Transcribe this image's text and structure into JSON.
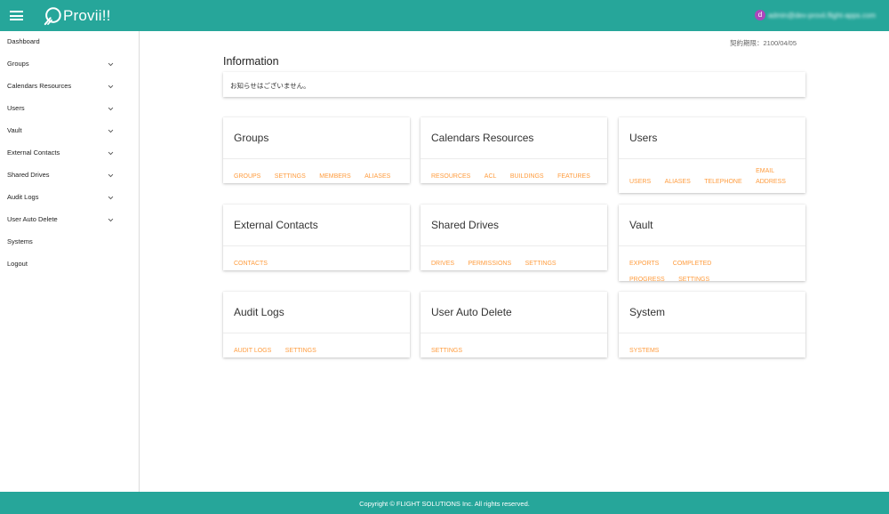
{
  "app": {
    "name": "Provii!!",
    "user_avatar_letter": "d",
    "user_email": "admin@dev-provii.flight-apps.com"
  },
  "colors": {
    "primary": "#26a69a",
    "link": "#ff9c3e",
    "avatar": "#ab47bc"
  },
  "sidebar": {
    "items": [
      {
        "label": "Dashboard",
        "expandable": false
      },
      {
        "label": "Groups",
        "expandable": true
      },
      {
        "label": "Calendars Resources",
        "expandable": true
      },
      {
        "label": "Users",
        "expandable": true
      },
      {
        "label": "Vault",
        "expandable": true
      },
      {
        "label": "External Contacts",
        "expandable": true
      },
      {
        "label": "Shared Drives",
        "expandable": true
      },
      {
        "label": "Audit Logs",
        "expandable": true
      },
      {
        "label": "User Auto Delete",
        "expandable": true
      },
      {
        "label": "Systems",
        "expandable": false
      },
      {
        "label": "Logout",
        "expandable": false
      }
    ]
  },
  "main": {
    "expiry": "契約期限：2100/04/05",
    "information_title": "Information",
    "information_text": "お知らせはございません。",
    "cards": [
      {
        "title": "Groups",
        "links": [
          "GROUPS",
          "SETTINGS",
          "MEMBERS",
          "ALIASES"
        ]
      },
      {
        "title": "Calendars Resources",
        "links": [
          "RESOURCES",
          "ACL",
          "BUILDINGS",
          "FEATURES"
        ]
      },
      {
        "title": "Users",
        "links": [
          "USERS",
          "ALIASES",
          "TELEPHONE",
          "EMAIL ADDRESS"
        ]
      },
      {
        "title": "External Contacts",
        "links": [
          "CONTACTS"
        ]
      },
      {
        "title": "Shared Drives",
        "links": [
          "DRIVES",
          "PERMISSIONS",
          "SETTINGS"
        ]
      },
      {
        "title": "Vault",
        "links": [
          "EXPORTS",
          "COMPLETED",
          "PROGRESS",
          "SETTINGS"
        ]
      },
      {
        "title": "Audit Logs",
        "links": [
          "AUDIT LOGS",
          "SETTINGS"
        ]
      },
      {
        "title": "User Auto Delete",
        "links": [
          "SETTINGS"
        ]
      },
      {
        "title": "System",
        "links": [
          "SYSTEMS"
        ]
      }
    ]
  },
  "footer": {
    "copyright": "Copyright © FLIGHT SOLUTIONS Inc. All rights reserved."
  }
}
